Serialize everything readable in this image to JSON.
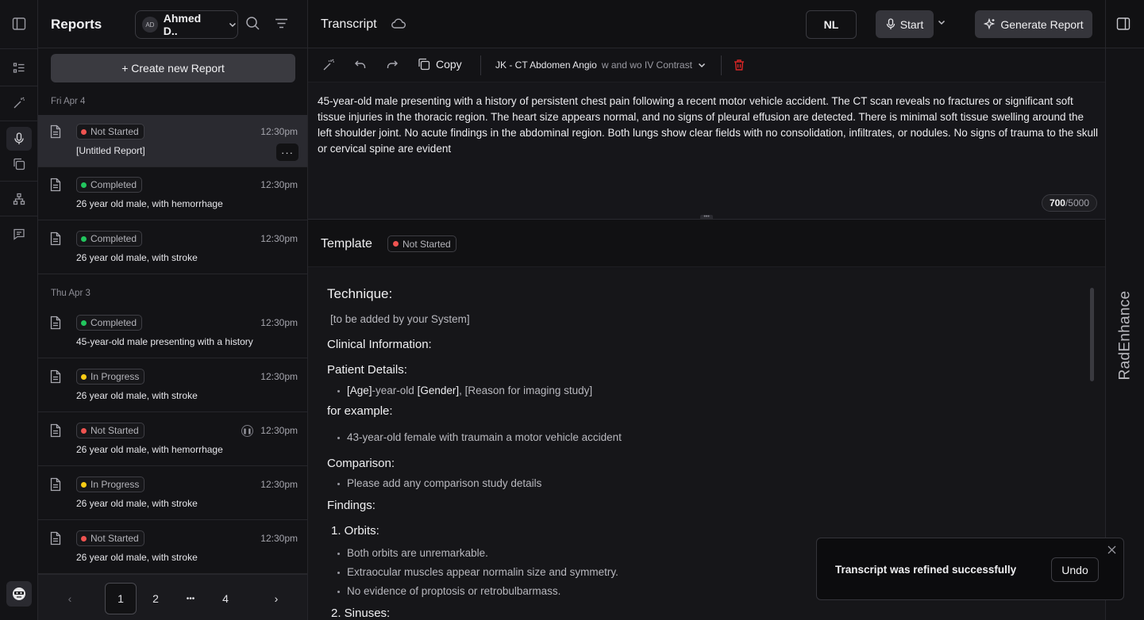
{
  "sidebar": {
    "title": "Reports",
    "user": {
      "initials": "AD",
      "name": "Ahmed D.."
    },
    "create_label": "+ Create new Report",
    "groups": [
      {
        "date": "Fri Apr 4"
      },
      {
        "date": "Thu Apr 3"
      }
    ],
    "items": [
      {
        "status": "Not Started",
        "status_color": "#ef5350",
        "time": "12:30pm",
        "title": "[Untitled Report]"
      },
      {
        "status": "Completed",
        "status_color": "#22c55e",
        "time": "12:30pm",
        "title": "26 year old male, with hemorrhage"
      },
      {
        "status": "Completed",
        "status_color": "#22c55e",
        "time": "12:30pm",
        "title": "26 year old male, with stroke"
      },
      {
        "status": "Completed",
        "status_color": "#22c55e",
        "time": "12:30pm",
        "title": "45-year-old male presenting with a history"
      },
      {
        "status": "In Progress",
        "status_color": "#facc15",
        "time": "12:30pm",
        "title": "26 year old male, with stroke"
      },
      {
        "status": "Not Started",
        "status_color": "#ef5350",
        "time": "12:30pm",
        "title": "26 year old male, with hemorrhage"
      },
      {
        "status": "In Progress",
        "status_color": "#facc15",
        "time": "12:30pm",
        "title": "26 year old male, with stroke"
      },
      {
        "status": "Not Started",
        "status_color": "#ef5350",
        "time": "12:30pm",
        "title": "26 year old male, with stroke"
      }
    ],
    "more_label": "···",
    "pager": {
      "pages": [
        "1",
        "2",
        "•••",
        "4"
      ],
      "prev": "‹",
      "next": "›"
    }
  },
  "header": {
    "title": "Transcript",
    "lang": "NL",
    "start_label": "Start",
    "generate_label": "Generate Report"
  },
  "toolbar": {
    "copy_label": "Copy",
    "template_name": "JK - CT Abdomen Angio",
    "template_suffix": "w and wo IV Contrast"
  },
  "transcript": {
    "text": "45-year-old male presenting with a history of persistent chest pain following a recent motor vehicle accident. The CT scan reveals no fractures or significant soft tissue injuries in the thoracic region. The heart size appears normal, and no signs of pleural effusion are detected. There is minimal soft tissue swelling around the left shoulder joint. No acute findings in the abdominal region. Both lungs show clear fields with no consolidation, infiltrates, or nodules. No signs of trauma to the skull or cervical spine are evident",
    "count": "700",
    "max": "/5000"
  },
  "template": {
    "title": "Template",
    "status": "Not Started",
    "technique_h": "Technique:",
    "technique_p": "[to be added by your System]",
    "clinical_h": "Clinical Information:",
    "patient_h": "Patient Details:",
    "patient_age": "[Age]",
    "patient_mid": "-year-old ",
    "patient_gender": "[Gender]",
    "patient_rest": ", [Reason for imaging study]",
    "example_h": "for example:",
    "example_p": "43-year-old female with traumain a motor vehicle accident",
    "comparison_h": "Comparison:",
    "comparison_p": "Please add any comparison study details",
    "findings_h": "Findings:",
    "orbits_h": "1. Orbits:",
    "orbits": [
      "Both orbits are unremarkable.",
      "Extraocular muscles appear normalin size and symmetry.",
      "No evidence of proptosis or retrobulbarmass."
    ],
    "sinuses_h": "2. Sinuses:"
  },
  "brand": "RadEnhance",
  "toast": {
    "message": "Transcript was refined successfully",
    "undo": "Undo"
  }
}
